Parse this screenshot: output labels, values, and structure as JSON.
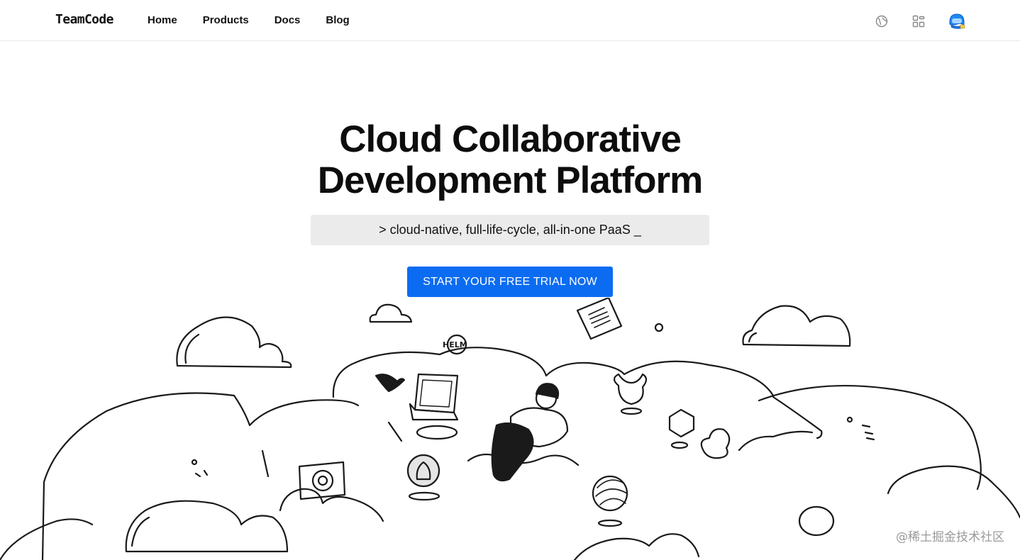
{
  "header": {
    "logo": "TeamCode",
    "nav": [
      {
        "label": "Home"
      },
      {
        "label": "Products"
      },
      {
        "label": "Docs"
      },
      {
        "label": "Blog"
      }
    ],
    "icons": [
      "globe-icon",
      "apps-grid-icon",
      "avatar"
    ]
  },
  "hero": {
    "title_line1": "Cloud Collaborative",
    "title_line2": "Development Platform",
    "terminal_text": "> cloud-native, full-life-cycle, all-in-one PaaS _",
    "cta_label": "START YOUR FREE TRIAL NOW"
  },
  "illustration": {
    "helm_label": "HELM"
  },
  "watermark": "@稀土掘金技术社区",
  "colors": {
    "accent": "#0b6cf2",
    "terminal_bg": "#ebebeb",
    "border": "#e8e8e8"
  }
}
